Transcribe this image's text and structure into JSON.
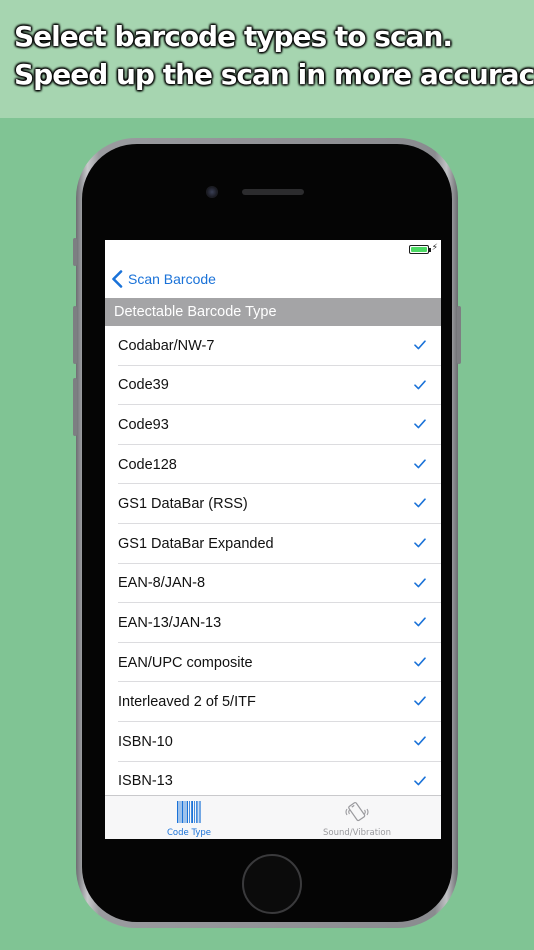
{
  "promo": {
    "line1": "Select barcode types to scan.",
    "line2": "Speed up the scan in more accuracy."
  },
  "status_bar": {
    "battery_icon": "battery-charging-icon"
  },
  "nav": {
    "back_label": "Scan Barcode",
    "back_icon": "chevron-left-icon"
  },
  "section": {
    "header": "Detectable Barcode Type"
  },
  "barcode_types": [
    {
      "label": "Codabar/NW-7",
      "checked": true
    },
    {
      "label": "Code39",
      "checked": true
    },
    {
      "label": "Code93",
      "checked": true
    },
    {
      "label": "Code128",
      "checked": true
    },
    {
      "label": "GS1 DataBar (RSS)",
      "checked": true
    },
    {
      "label": "GS1 DataBar Expanded",
      "checked": true
    },
    {
      "label": "EAN-8/JAN-8",
      "checked": true
    },
    {
      "label": "EAN-13/JAN-13",
      "checked": true
    },
    {
      "label": "EAN/UPC composite",
      "checked": true
    },
    {
      "label": "Interleaved 2 of 5/ITF",
      "checked": true
    },
    {
      "label": "ISBN-10",
      "checked": true
    },
    {
      "label": "ISBN-13",
      "checked": true
    }
  ],
  "tabs": [
    {
      "label": "Code Type",
      "icon": "barcode-icon",
      "active": true
    },
    {
      "label": "Sound/Vibration",
      "icon": "vibration-icon",
      "active": false
    }
  ],
  "colors": {
    "background": "#80c494",
    "promo_band": "#a6d5b0",
    "accent": "#1a72d8",
    "section_header": "#a4a4a6",
    "battery": "#4cd964"
  }
}
